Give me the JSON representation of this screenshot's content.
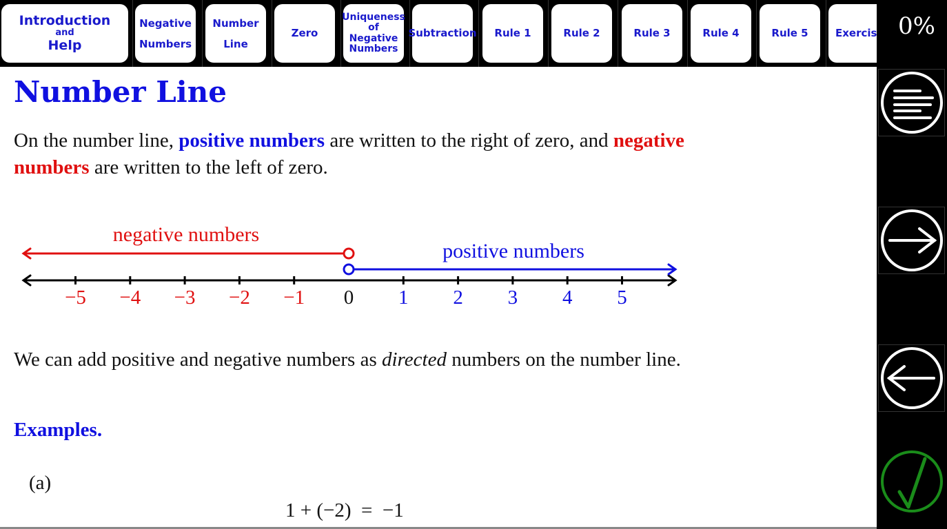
{
  "nav": {
    "tabs": [
      {
        "lines": [
          "Introduction",
          "and",
          "Help"
        ]
      },
      {
        "lines": [
          "Negative",
          "Numbers"
        ]
      },
      {
        "lines": [
          "Number",
          "Line"
        ]
      },
      {
        "lines": [
          "Zero"
        ]
      },
      {
        "lines": [
          "Uniqueness",
          "of",
          "Negative",
          "Numbers"
        ]
      },
      {
        "lines": [
          "Subtraction"
        ]
      },
      {
        "lines": [
          "Rule 1"
        ]
      },
      {
        "lines": [
          "Rule 2"
        ]
      },
      {
        "lines": [
          "Rule 3"
        ]
      },
      {
        "lines": [
          "Rule 4"
        ]
      },
      {
        "lines": [
          "Rule 5"
        ]
      },
      {
        "lines": [
          "Exercise"
        ]
      }
    ]
  },
  "sidebar": {
    "progress": "0%",
    "buttons": [
      {
        "name": "menu-button",
        "icon": "menu-lines-icon"
      },
      {
        "name": "next-button",
        "icon": "arrow-right-icon"
      },
      {
        "name": "previous-button",
        "icon": "arrow-left-icon"
      },
      {
        "name": "check-button",
        "icon": "checkmark-icon"
      }
    ],
    "check_color": "#1a8c1a"
  },
  "main": {
    "title": "Number Line",
    "intro": {
      "part1": "On the number line, ",
      "positive": "positive numbers",
      "part2": " are written to the right of zero, and ",
      "negative": "negative numbers",
      "part3": " are written to the left of zero."
    },
    "directed": {
      "part1": "We can add positive and negative numbers as ",
      "italic": "directed",
      "part2": " numbers on the number line."
    },
    "examples_heading": "Examples.",
    "example": {
      "label": "(a)",
      "equation": "1 + (−2)  =  −1"
    }
  },
  "number_line": {
    "negative_label": "negative numbers",
    "positive_label": "positive numbers",
    "ticks": [
      -5,
      -4,
      -3,
      -2,
      -1,
      0,
      1,
      2,
      3,
      4,
      5
    ],
    "tick_labels": [
      "−5",
      "−4",
      "−3",
      "−2",
      "−1",
      "0",
      "1",
      "2",
      "3",
      "4",
      "5"
    ],
    "colors": {
      "negative": "#e01010",
      "positive": "#1010e0",
      "axis": "#000000"
    }
  }
}
